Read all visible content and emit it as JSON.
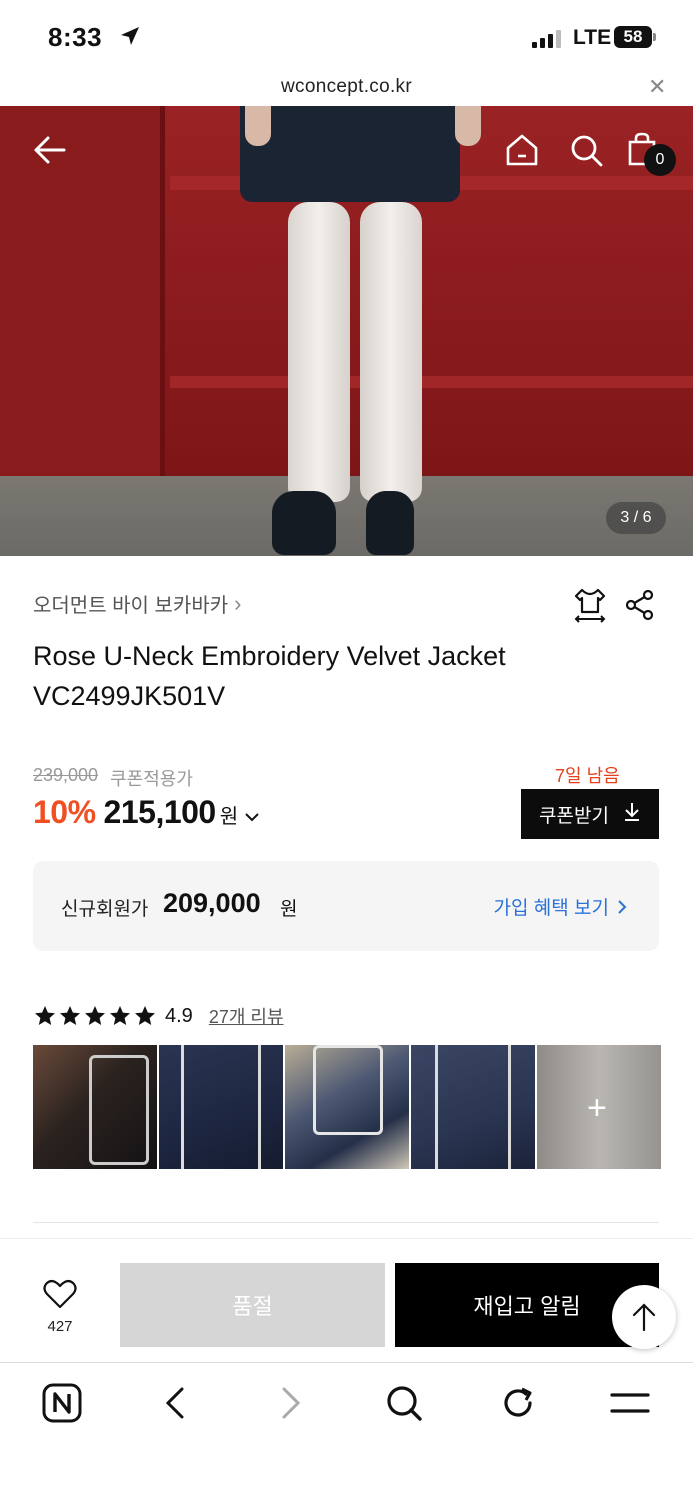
{
  "status_bar": {
    "time": "8:33",
    "network": "LTE",
    "battery": "58"
  },
  "url_bar": {
    "domain": "wconcept.co.kr"
  },
  "gallery": {
    "pager": "3 / 6",
    "cart_count": "0"
  },
  "product": {
    "brand": "오더먼트 바이 보카바카",
    "name": "Rose U-Neck Embroidery Velvet Jacket VC2499JK501V",
    "original_price": "239,000",
    "coupon_price_label": "쿠폰적용가",
    "discount": "10%",
    "price": "215,100",
    "currency": "원",
    "days_left": "7일 남음",
    "coupon_button": "쿠폰받기"
  },
  "member_offer": {
    "label": "신규회원가",
    "price": "209,000",
    "currency": "원",
    "link": "가입 혜택 보기"
  },
  "reviews": {
    "score": "4.9",
    "count_label": "27개 리뷰",
    "rating_stars": 5
  },
  "action_bar": {
    "wish_count": "427",
    "soldout_label": "품절",
    "restock_label": "재입고 알림"
  },
  "colors": {
    "discount": "#f04e23",
    "days_left": "#e2421d",
    "link": "#2a72d8",
    "primary_button": "#000000",
    "disabled_button": "#d6d6d6"
  }
}
